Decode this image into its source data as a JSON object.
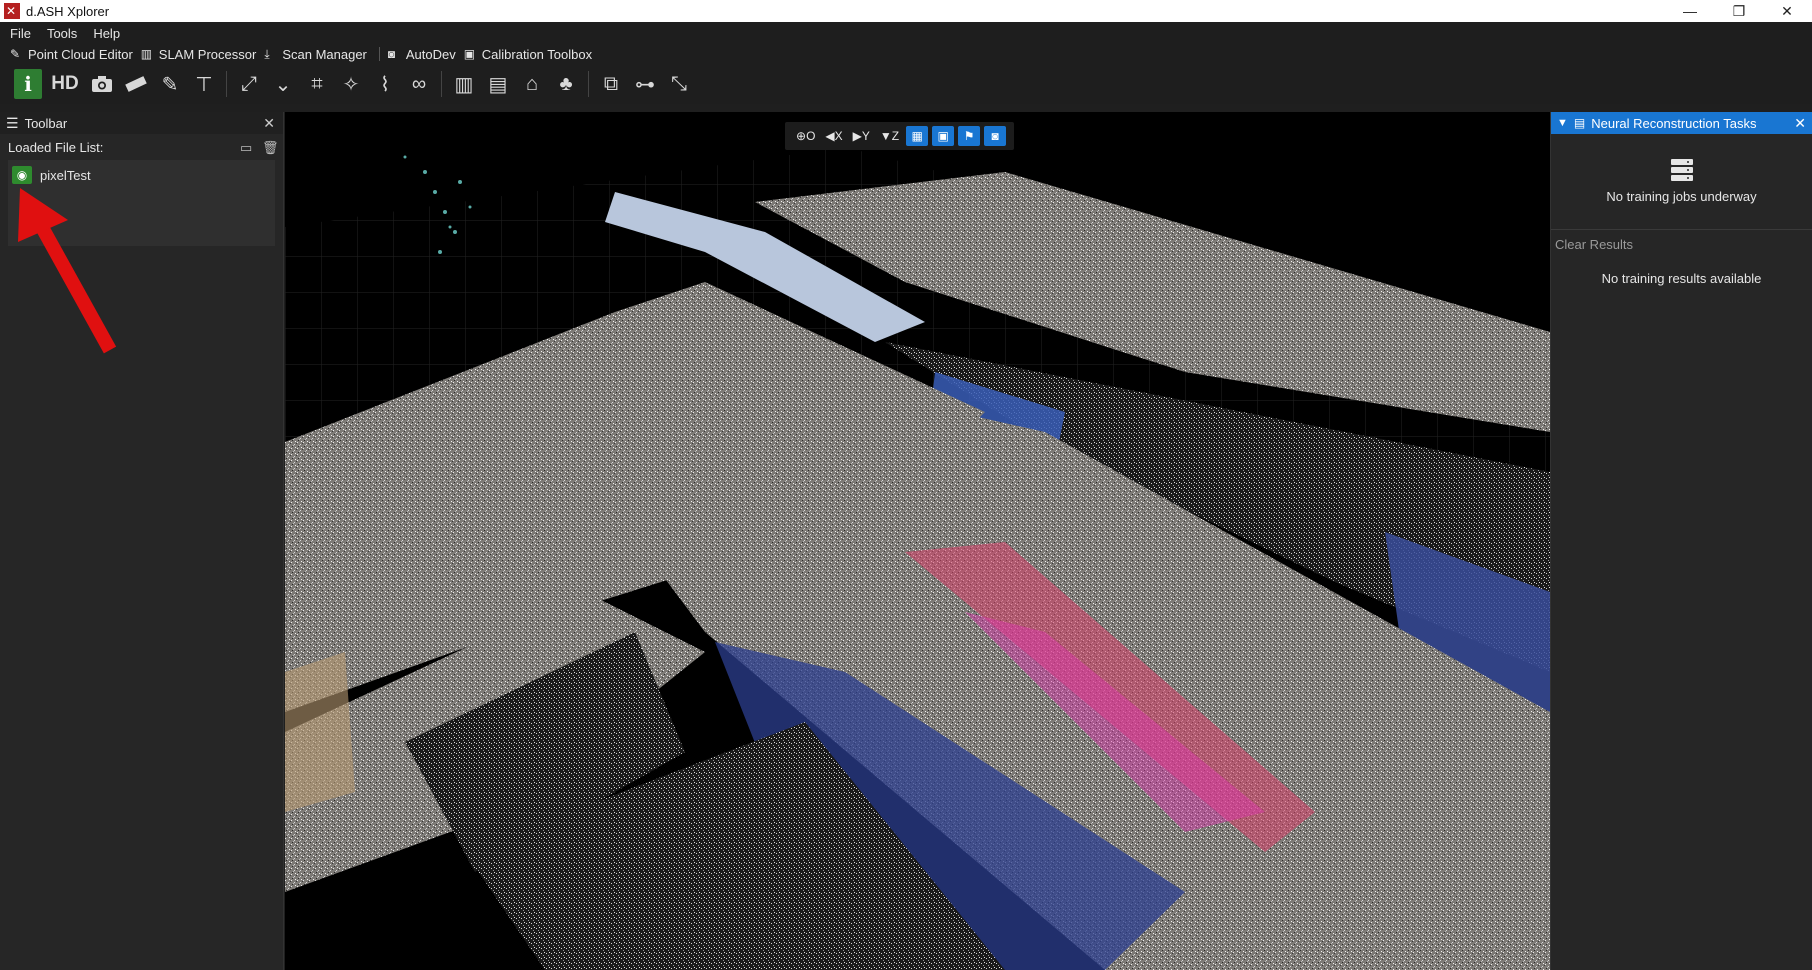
{
  "window": {
    "title": "d.ASH Xplorer",
    "controls": {
      "minimize": "—",
      "restore": "❐",
      "close": "✕"
    }
  },
  "menubar": {
    "items": [
      "File",
      "Tools",
      "Help"
    ]
  },
  "modes": [
    {
      "label": "Point Cloud Editor",
      "icon": "edit-icon"
    },
    {
      "label": "SLAM Processor",
      "icon": "map-icon"
    },
    {
      "label": "Scan Manager",
      "icon": "download-icon"
    },
    {
      "label": "AutoDev",
      "icon": "robot-icon"
    },
    {
      "label": "Calibration Toolbox",
      "icon": "toolbox-icon"
    }
  ],
  "toolbar": {
    "hd_label": "HD",
    "icons": [
      "info-icon",
      "hd-icon",
      "camera-icon",
      "ruler-icon",
      "pencil-icon",
      "signpost-icon",
      "expand-icon",
      "chevrons-down-icon",
      "crop-icon",
      "magic-wand-icon",
      "brush-icon",
      "handshake-icon",
      "map-icon",
      "building-icon",
      "house-icon",
      "tree-icon",
      "object-group-icon",
      "hierarchy-icon",
      "compress-icon"
    ]
  },
  "left_panel": {
    "title": "Toolbar",
    "file_list_label": "Loaded File List:",
    "files": [
      {
        "name": "pixelTest",
        "visible": true
      }
    ]
  },
  "view_controls": {
    "o_label": "O",
    "x_label": "X",
    "y_label": "Y",
    "z_label": "Z"
  },
  "right_panel": {
    "title": "Neural Reconstruction Tasks",
    "jobs_status": "No training jobs underway",
    "clear_label": "Clear Results",
    "results_status": "No training results available"
  },
  "colors": {
    "accent_blue": "#1976d2",
    "active_green": "#2e7d32",
    "annotation_red": "#e01010"
  }
}
